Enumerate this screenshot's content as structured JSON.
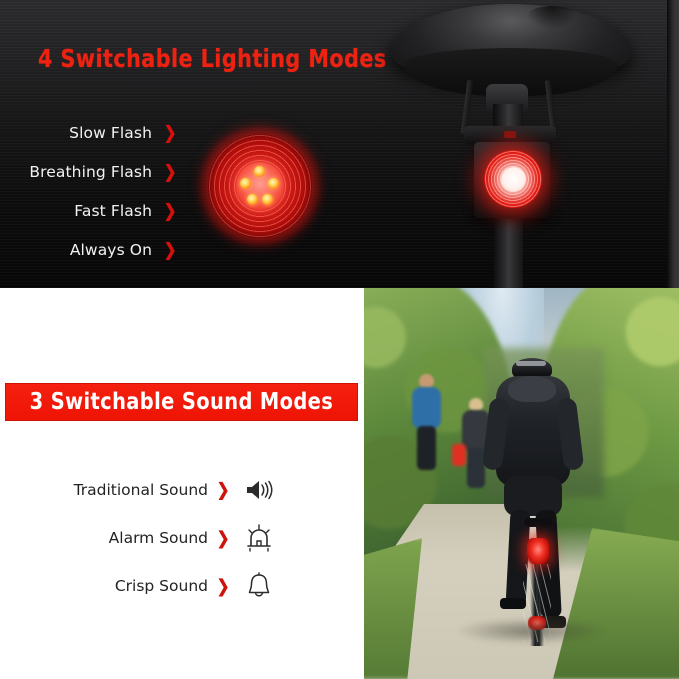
{
  "top_section": {
    "heading": "4 Switchable Lighting Modes",
    "heading_color": "#EE2211",
    "background_color": "#161617",
    "modes": [
      {
        "label": "Slow Flash",
        "chevron": "❯"
      },
      {
        "label": "Breathing Flash",
        "chevron": "❯"
      },
      {
        "label": "Fast Flash",
        "chevron": "❯"
      },
      {
        "label": "Always On",
        "chevron": "❯"
      }
    ],
    "lamp": {
      "name": "glowing-red-taillight-lens",
      "led_count": 5,
      "glow_color": "#EF2A20"
    },
    "product_photo": {
      "name": "bike-saddle-with-taillight",
      "light_color": "#F01E14"
    }
  },
  "bottom_section": {
    "banner_text": "3 Switchable Sound Modes",
    "banner_color": "#EE1405",
    "banner_text_color": "#FFFFFF",
    "sounds": [
      {
        "label": "Traditional Sound",
        "chevron": "❯",
        "icon": "speaker-waves-icon"
      },
      {
        "label": "Alarm Sound",
        "chevron": "❯",
        "icon": "alarm-siren-icon"
      },
      {
        "label": "Crisp Sound",
        "chevron": "❯",
        "icon": "bell-icon"
      }
    ],
    "lifestyle_photo": {
      "name": "cyclist-on-gravel-path",
      "description": "Cyclist riding away with red taillight, joggers ahead, green trees"
    }
  }
}
